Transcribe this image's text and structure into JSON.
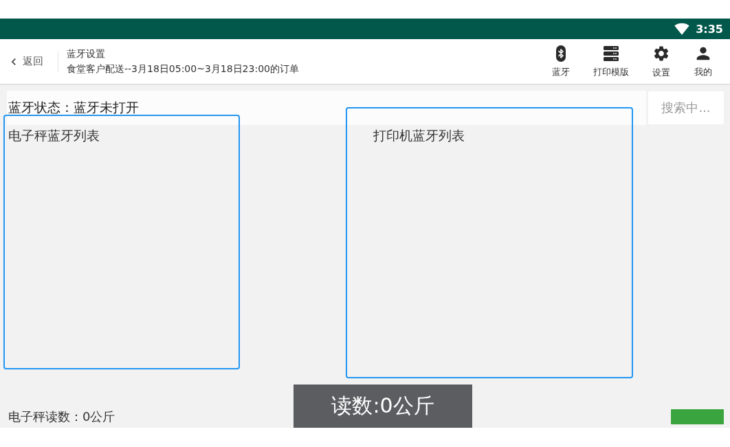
{
  "status_bar": {
    "time": "3:35"
  },
  "header": {
    "back_label": "返回",
    "title": "蓝牙设置",
    "subtitle": "食堂客户配送--3月18日05:00~3月18日23:00的订单",
    "actions": [
      {
        "kind": "bluetooth",
        "label": "蓝牙"
      },
      {
        "kind": "template",
        "label": "打印模版"
      },
      {
        "kind": "settings",
        "label": "设置"
      },
      {
        "kind": "profile",
        "label": "我的"
      }
    ]
  },
  "bluetooth_status": {
    "text": "蓝牙状态：蓝牙未打开"
  },
  "search_button": {
    "label": "搜索中..."
  },
  "scale_list": {
    "title": "电子秤蓝牙列表"
  },
  "printer_list": {
    "title": "打印机蓝牙列表"
  },
  "scale_reading": {
    "text": "电子秤读数：0公斤"
  },
  "toast": {
    "text": "读数:0公斤"
  }
}
